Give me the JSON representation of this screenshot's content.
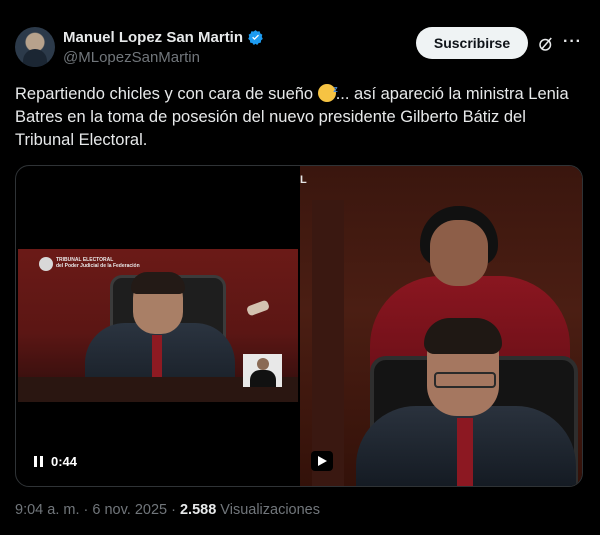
{
  "author": {
    "name": "Manuel Lopez San Martin",
    "handle": "@MLopezSanMartin",
    "verified_color": "#1d9bf0"
  },
  "actions": {
    "subscribe_label": "Suscribirse",
    "more_label": "···",
    "grok_icon": "grok-icon"
  },
  "post": {
    "text_before_emoji": "Repartiendo chicles y con cara de sueño ",
    "emoji": "sleeping-face-emoji",
    "text_after_emoji": "... así apareció la ministra Lenia Batres en la toma de posesión del nuevo presidente Gilberto Bátiz del Tribunal Electoral."
  },
  "video": {
    "time": "0:44",
    "overlay_left_logo_text": "TRIBUNAL ELECTORAL",
    "overlay_left_subtext": "del Poder Judicial de la Federación",
    "overlay_right_text": "L"
  },
  "footer": {
    "time": "9:04 a. m.",
    "sep1": " · ",
    "date": "6 nov. 2025",
    "sep2": " · ",
    "views_count": "2.588",
    "views_label": " Visualizaciones"
  }
}
